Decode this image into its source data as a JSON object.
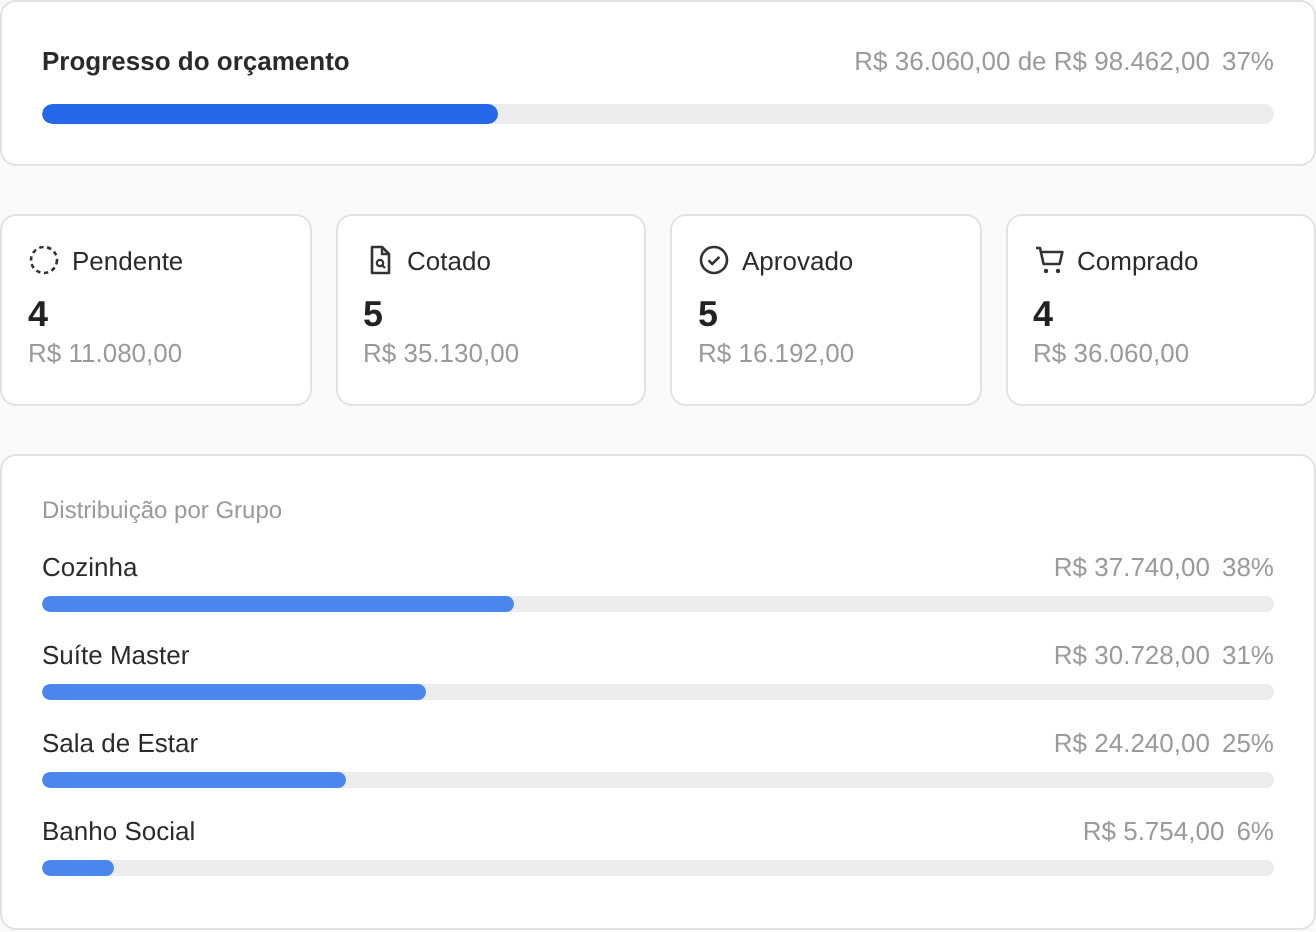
{
  "budget": {
    "title": "Progresso do orçamento",
    "amount": "R$ 36.060,00 de R$ 98.462,00",
    "percent": "37%",
    "level": 0.37
  },
  "stats": [
    {
      "kind": "pending",
      "label": "Pendente",
      "count": "4",
      "amount": "R$ 11.080,00"
    },
    {
      "kind": "quoted",
      "label": "Cotado",
      "count": "5",
      "amount": "R$ 35.130,00"
    },
    {
      "kind": "approved",
      "label": "Aprovado",
      "count": "5",
      "amount": "R$ 16.192,00"
    },
    {
      "kind": "purchased",
      "label": "Comprado",
      "count": "4",
      "amount": "R$ 36.060,00"
    }
  ],
  "groups": {
    "title": "Distribuição por Grupo",
    "items": [
      {
        "name": "Cozinha",
        "amount": "R$ 37.740,00",
        "percent": "38%",
        "level": 0.383
      },
      {
        "name": "Suíte Master",
        "amount": "R$ 30.728,00",
        "percent": "31%",
        "level": 0.312
      },
      {
        "name": "Sala de Estar",
        "amount": "R$ 24.240,00",
        "percent": "25%",
        "level": 0.246
      },
      {
        "name": "Banho Social",
        "amount": "R$ 5.754,00",
        "percent": "6%",
        "level": 0.058
      }
    ]
  }
}
